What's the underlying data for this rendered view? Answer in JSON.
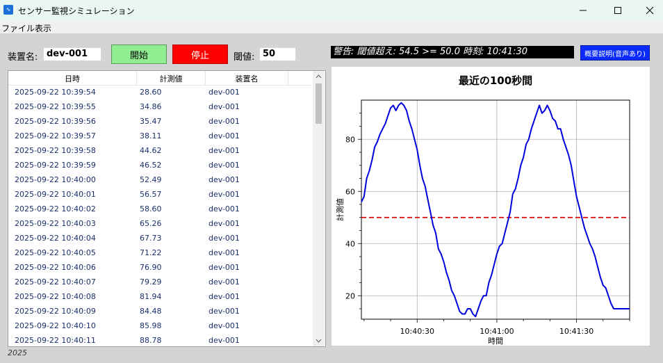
{
  "window": {
    "title": "センサー監視シミュレーション",
    "icon": "app-icon",
    "controls": [
      "minimize-icon",
      "maximize-icon",
      "close-icon"
    ]
  },
  "menu": [
    "ファイル",
    "表示"
  ],
  "controls": {
    "device_label": "装置名:",
    "device_value": "dev-001",
    "start_label": "開始",
    "stop_label": "停止",
    "threshold_label": "閾値:",
    "threshold_value": "50"
  },
  "alert_text": "警告: 閾値超え: 54.5 >= 50.0 時刻: 10:41:30",
  "help_button": "概要説明(音声あり)",
  "table": {
    "columns": [
      "日時",
      "計測値",
      "装置名"
    ],
    "rows": [
      [
        "2025-09-22 10:39:54",
        "28.60",
        "dev-001"
      ],
      [
        "2025-09-22 10:39:55",
        "34.86",
        "dev-001"
      ],
      [
        "2025-09-22 10:39:56",
        "35.47",
        "dev-001"
      ],
      [
        "2025-09-22 10:39:57",
        "38.11",
        "dev-001"
      ],
      [
        "2025-09-22 10:39:58",
        "44.62",
        "dev-001"
      ],
      [
        "2025-09-22 10:39:59",
        "46.52",
        "dev-001"
      ],
      [
        "2025-09-22 10:40:00",
        "52.49",
        "dev-001"
      ],
      [
        "2025-09-22 10:40:01",
        "56.57",
        "dev-001"
      ],
      [
        "2025-09-22 10:40:02",
        "58.60",
        "dev-001"
      ],
      [
        "2025-09-22 10:40:03",
        "65.26",
        "dev-001"
      ],
      [
        "2025-09-22 10:40:04",
        "67.73",
        "dev-001"
      ],
      [
        "2025-09-22 10:40:05",
        "71.22",
        "dev-001"
      ],
      [
        "2025-09-22 10:40:06",
        "76.90",
        "dev-001"
      ],
      [
        "2025-09-22 10:40:07",
        "79.29",
        "dev-001"
      ],
      [
        "2025-09-22 10:40:08",
        "81.94",
        "dev-001"
      ],
      [
        "2025-09-22 10:40:09",
        "84.48",
        "dev-001"
      ],
      [
        "2025-09-22 10:40:10",
        "85.98",
        "dev-001"
      ],
      [
        "2025-09-22 10:40:11",
        "88.78",
        "dev-001"
      ]
    ]
  },
  "status_text": "2025",
  "chart_data": {
    "type": "line",
    "title": "最近の100秒間",
    "xlabel": "時間",
    "ylabel": "計測値",
    "xlim": [
      "10:40:09",
      "10:41:50"
    ],
    "ylim": [
      11,
      95
    ],
    "xticks": [
      "10:40:30",
      "10:41:00",
      "10:41:30"
    ],
    "yticks": [
      20,
      40,
      60,
      80
    ],
    "grid": true,
    "series_color": "#0000dd",
    "threshold": 50,
    "threshold_color": "#dd0000",
    "x": [
      "10:40:09",
      "10:40:10",
      "10:40:11",
      "10:40:12",
      "10:40:13",
      "10:40:14",
      "10:40:15",
      "10:40:16",
      "10:40:17",
      "10:40:18",
      "10:40:19",
      "10:40:20",
      "10:40:21",
      "10:40:22",
      "10:40:23",
      "10:40:24",
      "10:40:25",
      "10:40:26",
      "10:40:27",
      "10:40:28",
      "10:40:29",
      "10:40:30",
      "10:40:31",
      "10:40:32",
      "10:40:33",
      "10:40:34",
      "10:40:35",
      "10:40:36",
      "10:40:37",
      "10:40:38",
      "10:40:39",
      "10:40:40",
      "10:40:41",
      "10:40:42",
      "10:40:43",
      "10:40:44",
      "10:40:45",
      "10:40:46",
      "10:40:47",
      "10:40:48",
      "10:40:49",
      "10:40:50",
      "10:40:51",
      "10:40:52",
      "10:40:53",
      "10:40:54",
      "10:40:55",
      "10:40:56",
      "10:40:57",
      "10:40:58",
      "10:40:59",
      "10:41:00",
      "10:41:01",
      "10:41:02",
      "10:41:03",
      "10:41:04",
      "10:41:05",
      "10:41:06",
      "10:41:07",
      "10:41:08",
      "10:41:09",
      "10:41:10",
      "10:41:11",
      "10:41:12",
      "10:41:13",
      "10:41:14",
      "10:41:15",
      "10:41:16",
      "10:41:17",
      "10:41:18",
      "10:41:19",
      "10:41:20",
      "10:41:21",
      "10:41:22",
      "10:41:23",
      "10:41:24",
      "10:41:25",
      "10:41:26",
      "10:41:27",
      "10:41:28",
      "10:41:29",
      "10:41:30",
      "10:41:31",
      "10:41:32",
      "10:41:33",
      "10:41:34",
      "10:41:35",
      "10:41:36",
      "10:41:37",
      "10:41:38",
      "10:41:39",
      "10:41:40",
      "10:41:41",
      "10:41:42",
      "10:41:43",
      "10:41:44",
      "10:41:45",
      "10:41:46",
      "10:41:47",
      "10:41:48",
      "10:41:49",
      "10:41:50"
    ],
    "values": [
      56,
      58,
      65,
      68,
      72,
      77,
      79,
      82,
      84,
      86,
      89,
      92,
      93,
      91,
      93,
      94,
      93,
      91,
      87,
      84,
      80,
      76,
      70,
      65,
      62,
      57,
      52,
      47,
      44,
      38,
      36,
      33,
      29,
      26,
      22,
      20,
      17,
      14,
      13,
      13,
      15,
      15,
      13,
      12,
      15,
      18,
      20,
      20,
      25,
      28,
      32,
      36,
      39,
      40,
      44,
      48,
      52,
      59,
      61,
      65,
      70,
      73,
      78,
      80,
      84,
      87,
      90,
      93,
      90,
      91,
      93,
      91,
      88,
      87,
      84,
      84,
      80,
      77,
      74,
      70,
      64,
      58,
      54,
      50,
      46,
      43,
      40,
      38,
      35,
      31,
      27,
      24,
      23,
      20,
      17,
      15,
      15,
      15,
      15,
      15,
      15,
      15
    ]
  }
}
